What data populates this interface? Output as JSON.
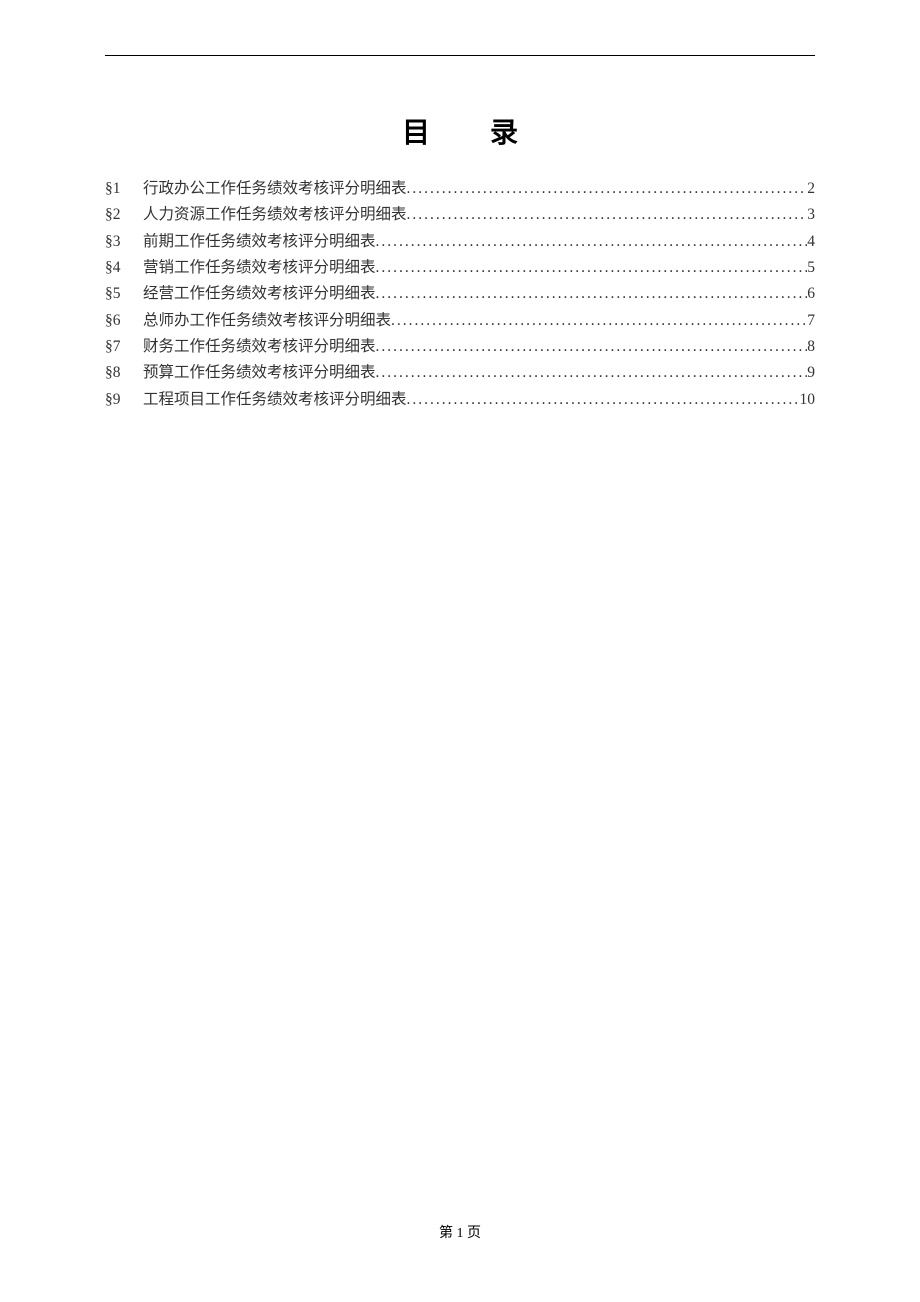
{
  "title": "目录",
  "toc": {
    "entries": [
      {
        "num": "§1",
        "text": "行政办公工作任务绩效考核评分明细表",
        "page": "2"
      },
      {
        "num": "§2",
        "text": "人力资源工作任务绩效考核评分明细表",
        "page": "3"
      },
      {
        "num": "§3",
        "text": "前期工作任务绩效考核评分明细表",
        "page": "4"
      },
      {
        "num": "§4",
        "text": "营销工作任务绩效考核评分明细表",
        "page": "5"
      },
      {
        "num": "§5",
        "text": "经营工作任务绩效考核评分明细表",
        "page": "6"
      },
      {
        "num": "§6",
        "text": "总师办工作任务绩效考核评分明细表",
        "page": "7"
      },
      {
        "num": "§7",
        "text": "财务工作任务绩效考核评分明细表",
        "page": "8"
      },
      {
        "num": "§8",
        "text": "预算工作任务绩效考核评分明细表",
        "page": "9"
      },
      {
        "num": "§9",
        "text": "工程项目工作任务绩效考核评分明细表",
        "page": "10"
      }
    ]
  },
  "footer": {
    "prefix": "第 ",
    "page_num": "1",
    "suffix": " 页"
  }
}
